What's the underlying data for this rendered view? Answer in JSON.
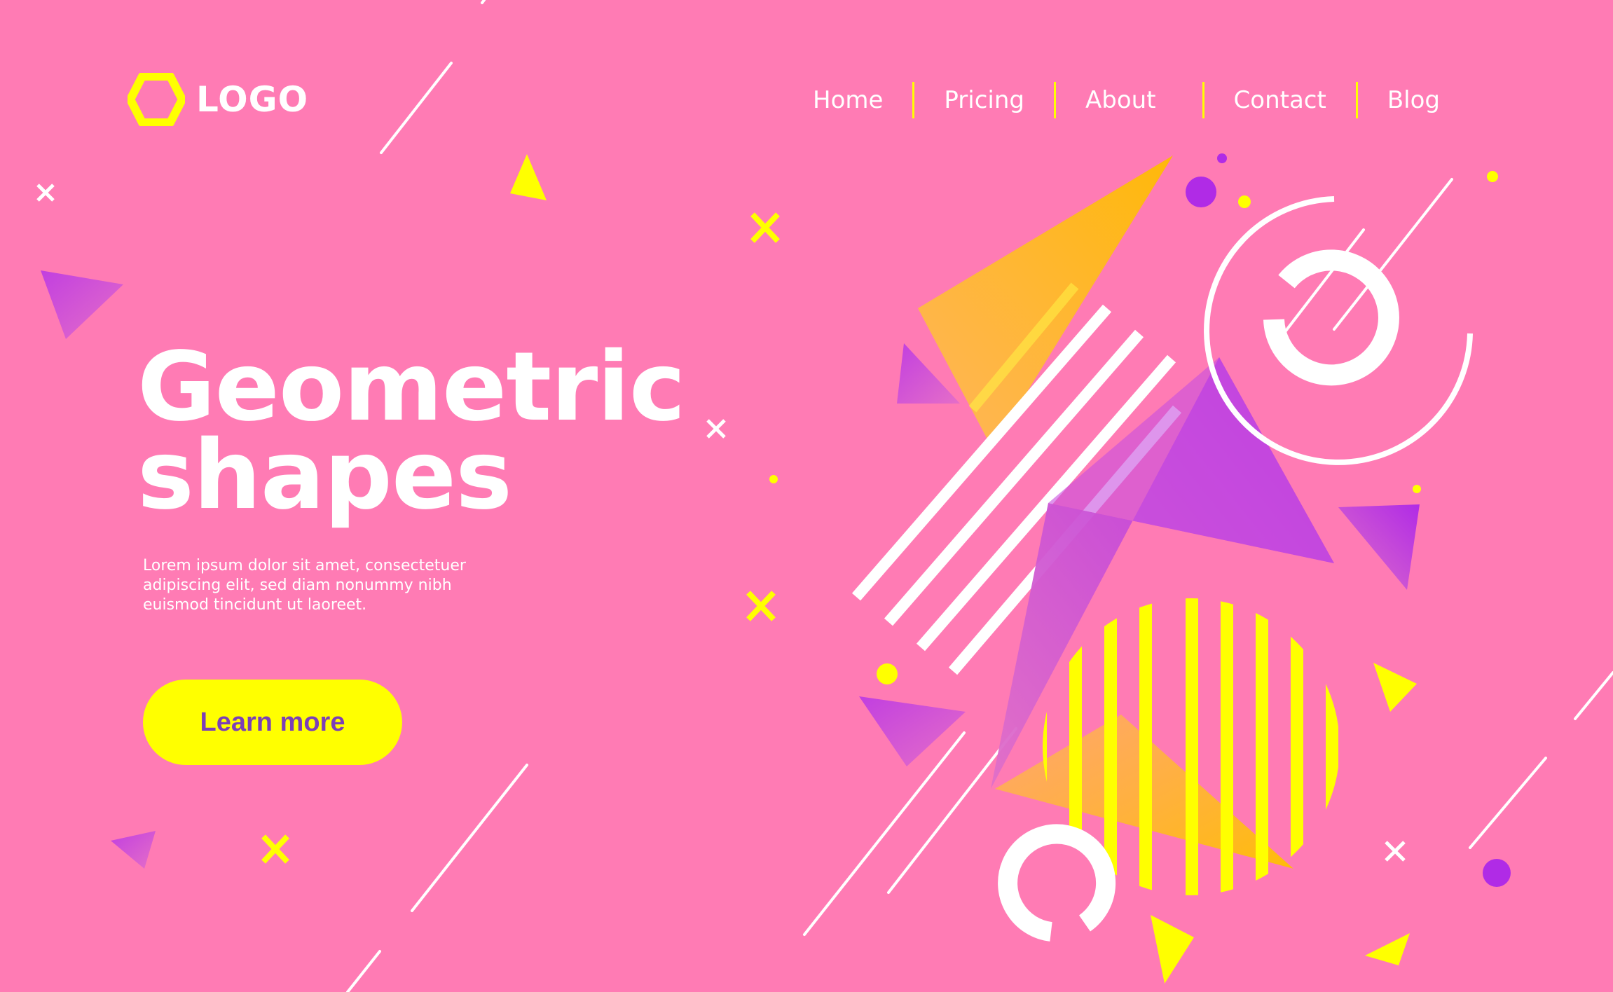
{
  "brand": {
    "logo_text": "LOGO",
    "logo_icon": "hexagon-icon"
  },
  "nav": {
    "items": [
      {
        "label": "Home"
      },
      {
        "label": "Pricing"
      },
      {
        "label": "About"
      },
      {
        "label": "Contact"
      },
      {
        "label": "Blog"
      }
    ]
  },
  "hero": {
    "title_line1": "Geometric",
    "title_line2": "shapes",
    "description": "Lorem ipsum dolor sit amet, consectetuer adipiscing elit, sed diam nonummy nibh euismod tincidunt ut laoreet.",
    "cta_label": "Learn more"
  },
  "colors": {
    "background": "#ff7bb4",
    "accent_yellow": "#ffff00",
    "accent_purple": "#b02be6",
    "accent_orange": "#ffb81c",
    "text": "#ffffff",
    "cta_text": "#7b3fb8"
  }
}
